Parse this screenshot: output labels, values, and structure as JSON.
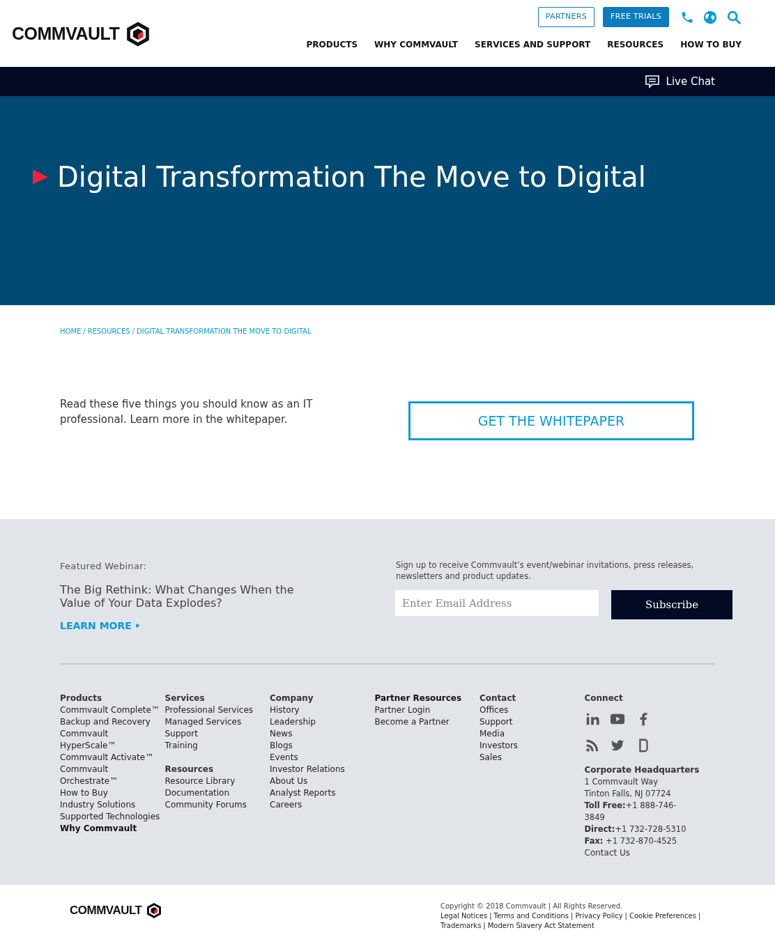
{
  "header": {
    "logo": "COMMVAULT",
    "top_buttons": [
      {
        "label": "PARTNERS",
        "kind": "outline"
      },
      {
        "label": "FREE TRIALS",
        "kind": "filled"
      }
    ],
    "nav": [
      "PRODUCTS",
      "WHY COMMVAULT",
      "SERVICES AND SUPPORT",
      "RESOURCES",
      "HOW TO BUY"
    ]
  },
  "chat_bar": {
    "label": "Live Chat"
  },
  "hero": {
    "title": "Digital Transformation The Move to Digital"
  },
  "breadcrumb": [
    {
      "text": "HOME",
      "separator_after": "/"
    },
    {
      "text": "RESOURCES",
      "separator_after": "/"
    },
    {
      "text": "DIGITAL TRANSFORMATION THE MOVE TO DIGITAL"
    }
  ],
  "intro": {
    "text": "Read these five things you should know as an IT professional. Learn more in the whitepaper.",
    "button": "GET THE WHITEPAPER"
  },
  "webinar": {
    "label": "Featured Webinar:",
    "title": "The Big Rethink: What Changes When the Value of Your Data Explodes?",
    "link": "LEARN MORE"
  },
  "signup": {
    "text": "Sign up to receive Commvault’s event/webinar invitations, press releases, newsletters and product updates.",
    "placeholder": "Enter Email Address",
    "button": "Subscribe"
  },
  "footer_columns": [
    [
      {
        "kind": "heading",
        "text": "Products"
      },
      {
        "kind": "link",
        "text": "Commvault Complete™"
      },
      {
        "kind": "link",
        "text": "Backup and Recovery"
      },
      {
        "kind": "link",
        "text": "Commvault"
      },
      {
        "kind": "link",
        "text": "HyperScale™"
      },
      {
        "kind": "link",
        "text": "Commvault Activate™"
      },
      {
        "kind": "link",
        "text": "Commvault"
      },
      {
        "kind": "link",
        "text": "Orchestrate™"
      },
      {
        "kind": "link",
        "text": "How to Buy"
      },
      {
        "kind": "link",
        "text": "Industry Solutions"
      },
      {
        "kind": "link",
        "text": "Supported Technologies"
      },
      {
        "kind": "strong",
        "text": "Why Commvault"
      }
    ],
    [
      {
        "kind": "heading",
        "text": "Services"
      },
      {
        "kind": "link",
        "text": "Professional Services"
      },
      {
        "kind": "link",
        "text": "Managed Services"
      },
      {
        "kind": "link",
        "text": "Support"
      },
      {
        "kind": "link",
        "text": "Training"
      },
      {
        "kind": "spacer"
      },
      {
        "kind": "heading",
        "text": "Resources"
      },
      {
        "kind": "link",
        "text": "Resource Library"
      },
      {
        "kind": "link",
        "text": "Documentation"
      },
      {
        "kind": "link",
        "text": "Community Forums"
      }
    ],
    [
      {
        "kind": "heading",
        "text": "Company"
      },
      {
        "kind": "link",
        "text": "History"
      },
      {
        "kind": "link",
        "text": "Leadership"
      },
      {
        "kind": "link",
        "text": "News"
      },
      {
        "kind": "link",
        "text": "Blogs"
      },
      {
        "kind": "link",
        "text": "Events"
      },
      {
        "kind": "link",
        "text": "Investor Relations"
      },
      {
        "kind": "link",
        "text": "About Us"
      },
      {
        "kind": "link",
        "text": "Analyst Reports"
      },
      {
        "kind": "link",
        "text": "Careers"
      }
    ],
    [
      {
        "kind": "strong",
        "text": "Partner Resources"
      },
      {
        "kind": "link",
        "text": "Partner Login"
      },
      {
        "kind": "link",
        "text": "Become a Partner"
      }
    ],
    [
      {
        "kind": "heading",
        "text": "Contact"
      },
      {
        "kind": "link",
        "text": "Offices"
      },
      {
        "kind": "link",
        "text": "Support"
      },
      {
        "kind": "link",
        "text": "Media"
      },
      {
        "kind": "link",
        "text": "Investors"
      },
      {
        "kind": "link",
        "text": "Sales"
      }
    ]
  ],
  "connect": {
    "heading": "Connect",
    "hq_heading": "Corporate Headquarters",
    "hq_lines": [
      "1 Commvault Way",
      "Tinton Falls, NJ 07724",
      "**Toll Free:**+1 888-746-3849",
      "**Direct:**+1 732-728-5310",
      "**Fax:** +1 732-870-4525"
    ],
    "contact_link": "Contact Us"
  },
  "bottom": {
    "logo": "COMMVAULT",
    "copyright": "Copyright © 2018 Commvault | All Rights Reserved.",
    "links": [
      {
        "text": "Legal Notices",
        "separator_after": "|"
      },
      {
        "text": "Terms and Conditions",
        "separator_after": "|"
      },
      {
        "text": "Privacy Policy",
        "separator_after": "|"
      },
      {
        "text": "Cookie Preferences",
        "separator_after": "|"
      },
      {
        "text": "Trademarks",
        "separator_after": "|"
      },
      {
        "text": "Modern Slavery Act Statement"
      }
    ]
  }
}
